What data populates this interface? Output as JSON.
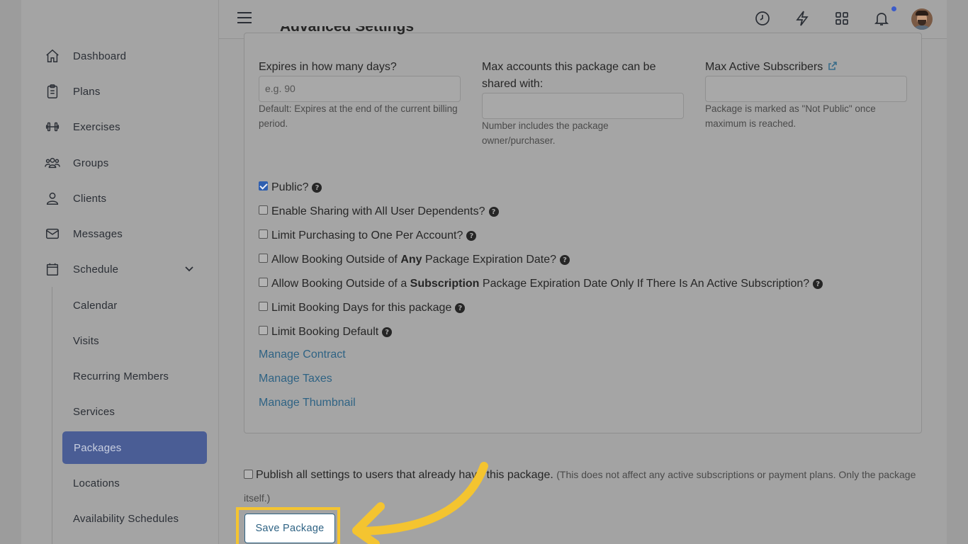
{
  "sidebar": {
    "items": [
      {
        "label": "Dashboard",
        "icon": "home-icon"
      },
      {
        "label": "Plans",
        "icon": "clipboard-icon"
      },
      {
        "label": "Exercises",
        "icon": "dumbbell-icon"
      },
      {
        "label": "Groups",
        "icon": "users-icon"
      },
      {
        "label": "Clients",
        "icon": "user-icon"
      },
      {
        "label": "Messages",
        "icon": "envelope-icon"
      },
      {
        "label": "Schedule",
        "icon": "calendar-icon"
      }
    ],
    "schedule_sub": [
      {
        "label": "Calendar"
      },
      {
        "label": "Visits"
      },
      {
        "label": "Recurring Members"
      },
      {
        "label": "Services"
      },
      {
        "label": "Packages",
        "active": true
      },
      {
        "label": "Locations"
      },
      {
        "label": "Availability Schedules"
      }
    ]
  },
  "topbar": {
    "icons": [
      "menu-icon",
      "clock-icon",
      "lightning-icon",
      "apps-grid-icon",
      "bell-icon",
      "avatar"
    ]
  },
  "panel": {
    "title": "Advanced Settings",
    "fields": [
      {
        "label": "Expires in how many days?",
        "placeholder": "e.g. 90",
        "value": "",
        "help": "Default: Expires at the end of the current billing period."
      },
      {
        "label": "Max accounts this package can be shared with:",
        "placeholder": "",
        "value": "",
        "help": "Number includes the package owner/purchaser."
      },
      {
        "label": "Max Active Subscribers",
        "placeholder": "",
        "value": "",
        "help": "Package is marked as \"Not Public\" once maximum is reached."
      }
    ],
    "checkboxes": [
      {
        "text": "Public?",
        "checked": true
      },
      {
        "text": "Enable Sharing with All User Dependents?",
        "checked": false
      },
      {
        "text": "Limit Purchasing to One Per Account?",
        "checked": false
      },
      {
        "pre": "Allow Booking Outside of ",
        "bold": "Any",
        "post": " Package Expiration Date?",
        "checked": false
      },
      {
        "pre": "Allow Booking Outside of a ",
        "bold": "Subscription",
        "post": " Package Expiration Date Only If There Is An Active Subscription?",
        "checked": false
      },
      {
        "text": "Limit Booking Days for this package",
        "checked": false
      },
      {
        "text": "Limit Booking Default",
        "checked": false
      }
    ],
    "links": [
      "Manage Contract",
      "Manage Taxes",
      "Manage Thumbnail"
    ]
  },
  "publish": {
    "label": "Publish all settings to users that already have this package.",
    "note": "(This does not affect any active subscriptions or payment plans. Only the package itself.)",
    "checked": false
  },
  "save_button": "Save Package",
  "colors": {
    "accent": "#2f6384",
    "active_nav": "#4a5d95",
    "highlight": "#f4c430"
  }
}
